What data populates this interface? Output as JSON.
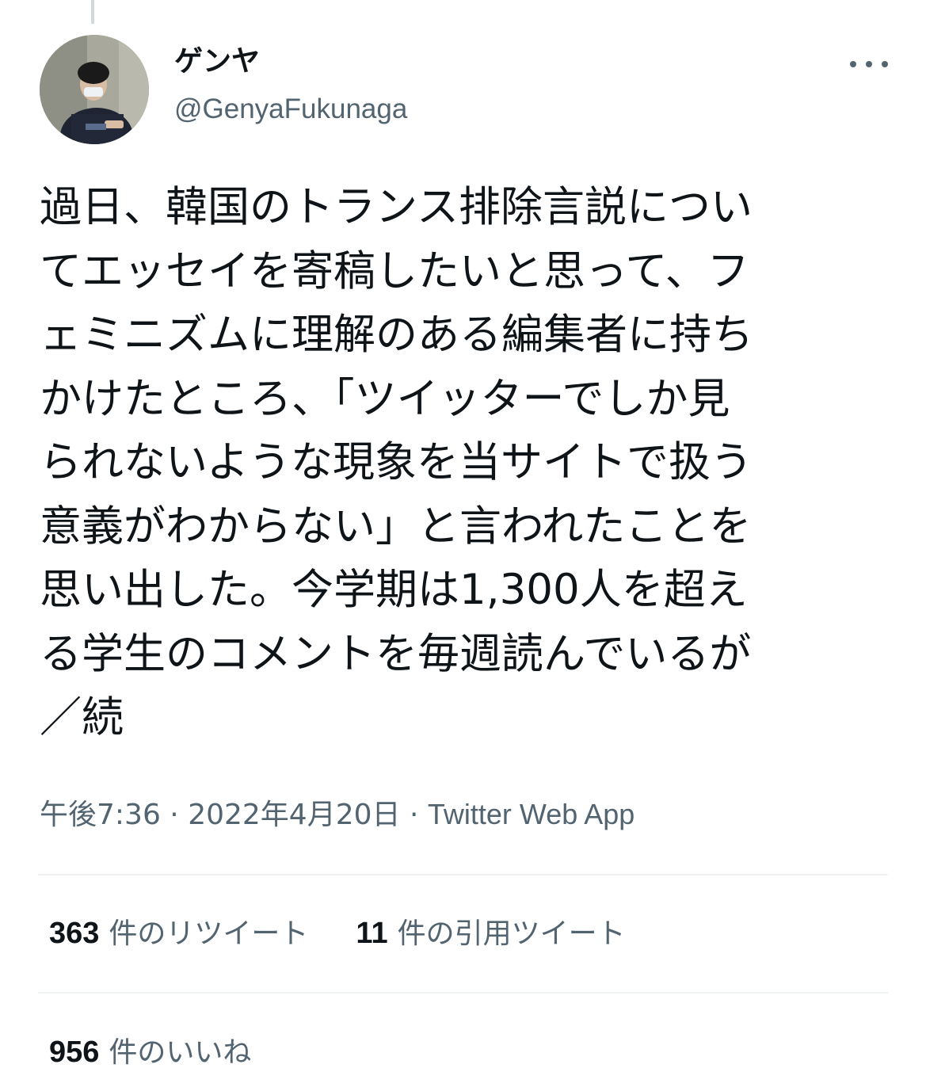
{
  "user": {
    "display_name": "ゲンヤ",
    "handle": "@GenyaFukunaga",
    "avatar_icon": "user-photo-avatar"
  },
  "tweet": {
    "text": "過日、韓国のトランス排除言説につい\nてエッセイを寄稿したいと思って、フ\nェミニズムに理解のある編集者に持ち\nかけたところ、「ツイッターでしか見\nられないような現象を当サイトで扱う\n意義がわからない」と言われたことを\n思い出した。今学期は1,300人を超え\nる学生のコメントを毎週読んでいるが\n／続"
  },
  "meta": {
    "time": "午後7:36",
    "separator": " · ",
    "date": "2022年4月20日",
    "source": "Twitter Web App"
  },
  "stats": {
    "retweets_count": "363",
    "retweets_label": "件のリツイート",
    "quotes_count": "11",
    "quotes_label": "件の引用ツイート",
    "likes_count": "956",
    "likes_label": "件のいいね"
  },
  "colors": {
    "text_primary": "#0f1419",
    "text_secondary": "#536471",
    "divider": "#eff3f4"
  }
}
